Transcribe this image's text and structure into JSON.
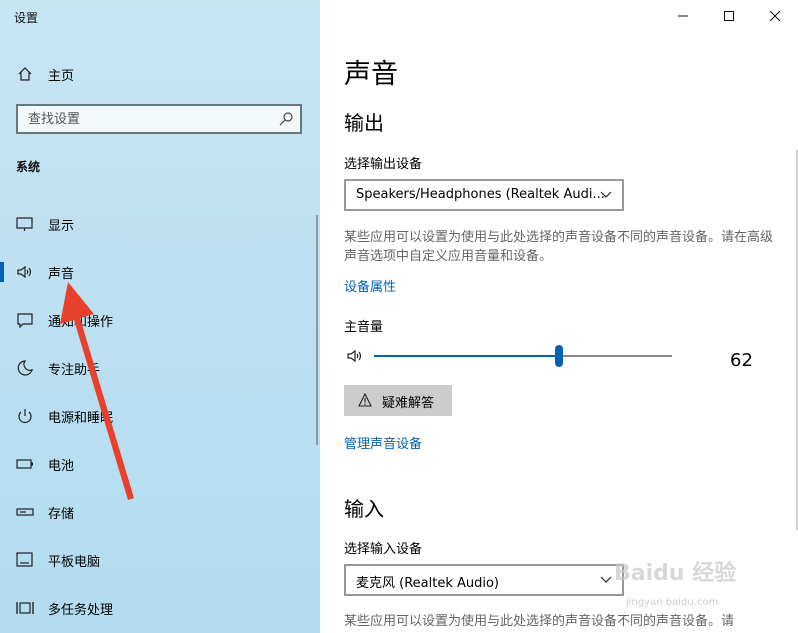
{
  "app": {
    "title": "设置"
  },
  "sidebar": {
    "home": {
      "label": "主页",
      "icon": "home-icon"
    },
    "search": {
      "placeholder": "查找设置",
      "icon": "search-icon"
    },
    "section": "系统",
    "items": [
      {
        "label": "显示",
        "icon": "monitor-icon"
      },
      {
        "label": "声音",
        "icon": "speaker-icon",
        "active": true
      },
      {
        "label": "通知和操作",
        "icon": "notification-icon"
      },
      {
        "label": "专注助手",
        "icon": "moon-icon"
      },
      {
        "label": "电源和睡眠",
        "icon": "power-icon"
      },
      {
        "label": "电池",
        "icon": "battery-icon"
      },
      {
        "label": "存储",
        "icon": "storage-icon"
      },
      {
        "label": "平板电脑",
        "icon": "tablet-icon"
      },
      {
        "label": "多任务处理",
        "icon": "multitask-icon"
      }
    ]
  },
  "window": {
    "minimize_icon": "minimize-icon",
    "maximize_icon": "maximize-icon",
    "close_icon": "close-icon"
  },
  "main": {
    "title": "声音",
    "output": {
      "heading": "输出",
      "device_label": "选择输出设备",
      "device_value": "Speakers/Headphones (Realtek Audi...",
      "description": "某些应用可以设置为使用与此处选择的声音设备不同的声音设备。请在高级声音选项中自定义应用音量和设备。",
      "properties_link": "设备属性",
      "volume_label": "主音量",
      "volume_value": "62",
      "volume_level": 0.62,
      "troubleshoot_label": "疑难解答",
      "manage_link": "管理声音设备"
    },
    "input": {
      "heading": "输入",
      "device_label": "选择输入设备",
      "device_value": "麦克风 (Realtek Audio)",
      "description": "某些应用可以设置为使用与此处选择的声音设备不同的声音设备。请"
    }
  },
  "watermark": {
    "text": "Baidu 经验",
    "sub": "jingyan.baidu.com"
  },
  "colors": {
    "accent": "#0063b1",
    "annotation_arrow": "#e8412b"
  }
}
